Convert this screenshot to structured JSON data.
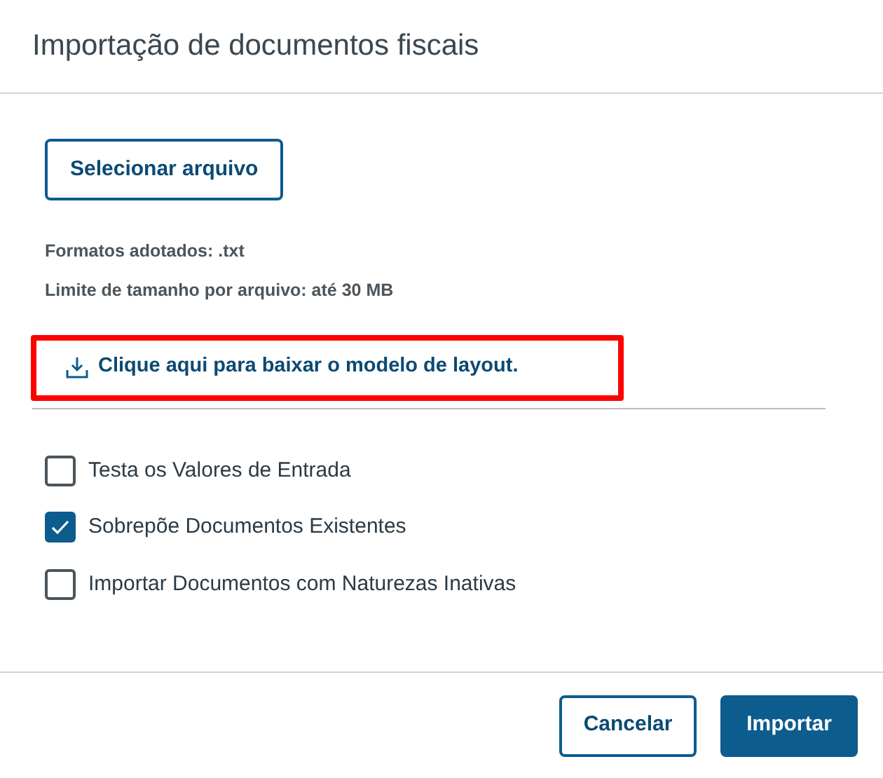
{
  "dialog": {
    "title": "Importação de documentos fiscais"
  },
  "file_button": "Selecionar arquivo",
  "info": [
    "Formatos adotados: .txt",
    "Limite de tamanho por arquivo: até 30 MB"
  ],
  "download_link": {
    "label": "Clique aqui para baixar o modelo de layout.",
    "highlighted": true
  },
  "options": [
    {
      "label": "Testa os Valores de Entrada",
      "checked": false
    },
    {
      "label": "Sobrepõe Documentos Existentes",
      "checked": true
    },
    {
      "label": "Importar Documentos com Naturezas Inativas",
      "checked": false
    }
  ],
  "buttons": [
    {
      "label": "Cancelar",
      "kind": "secondary"
    },
    {
      "label": "Importar",
      "kind": "primary"
    }
  ]
}
